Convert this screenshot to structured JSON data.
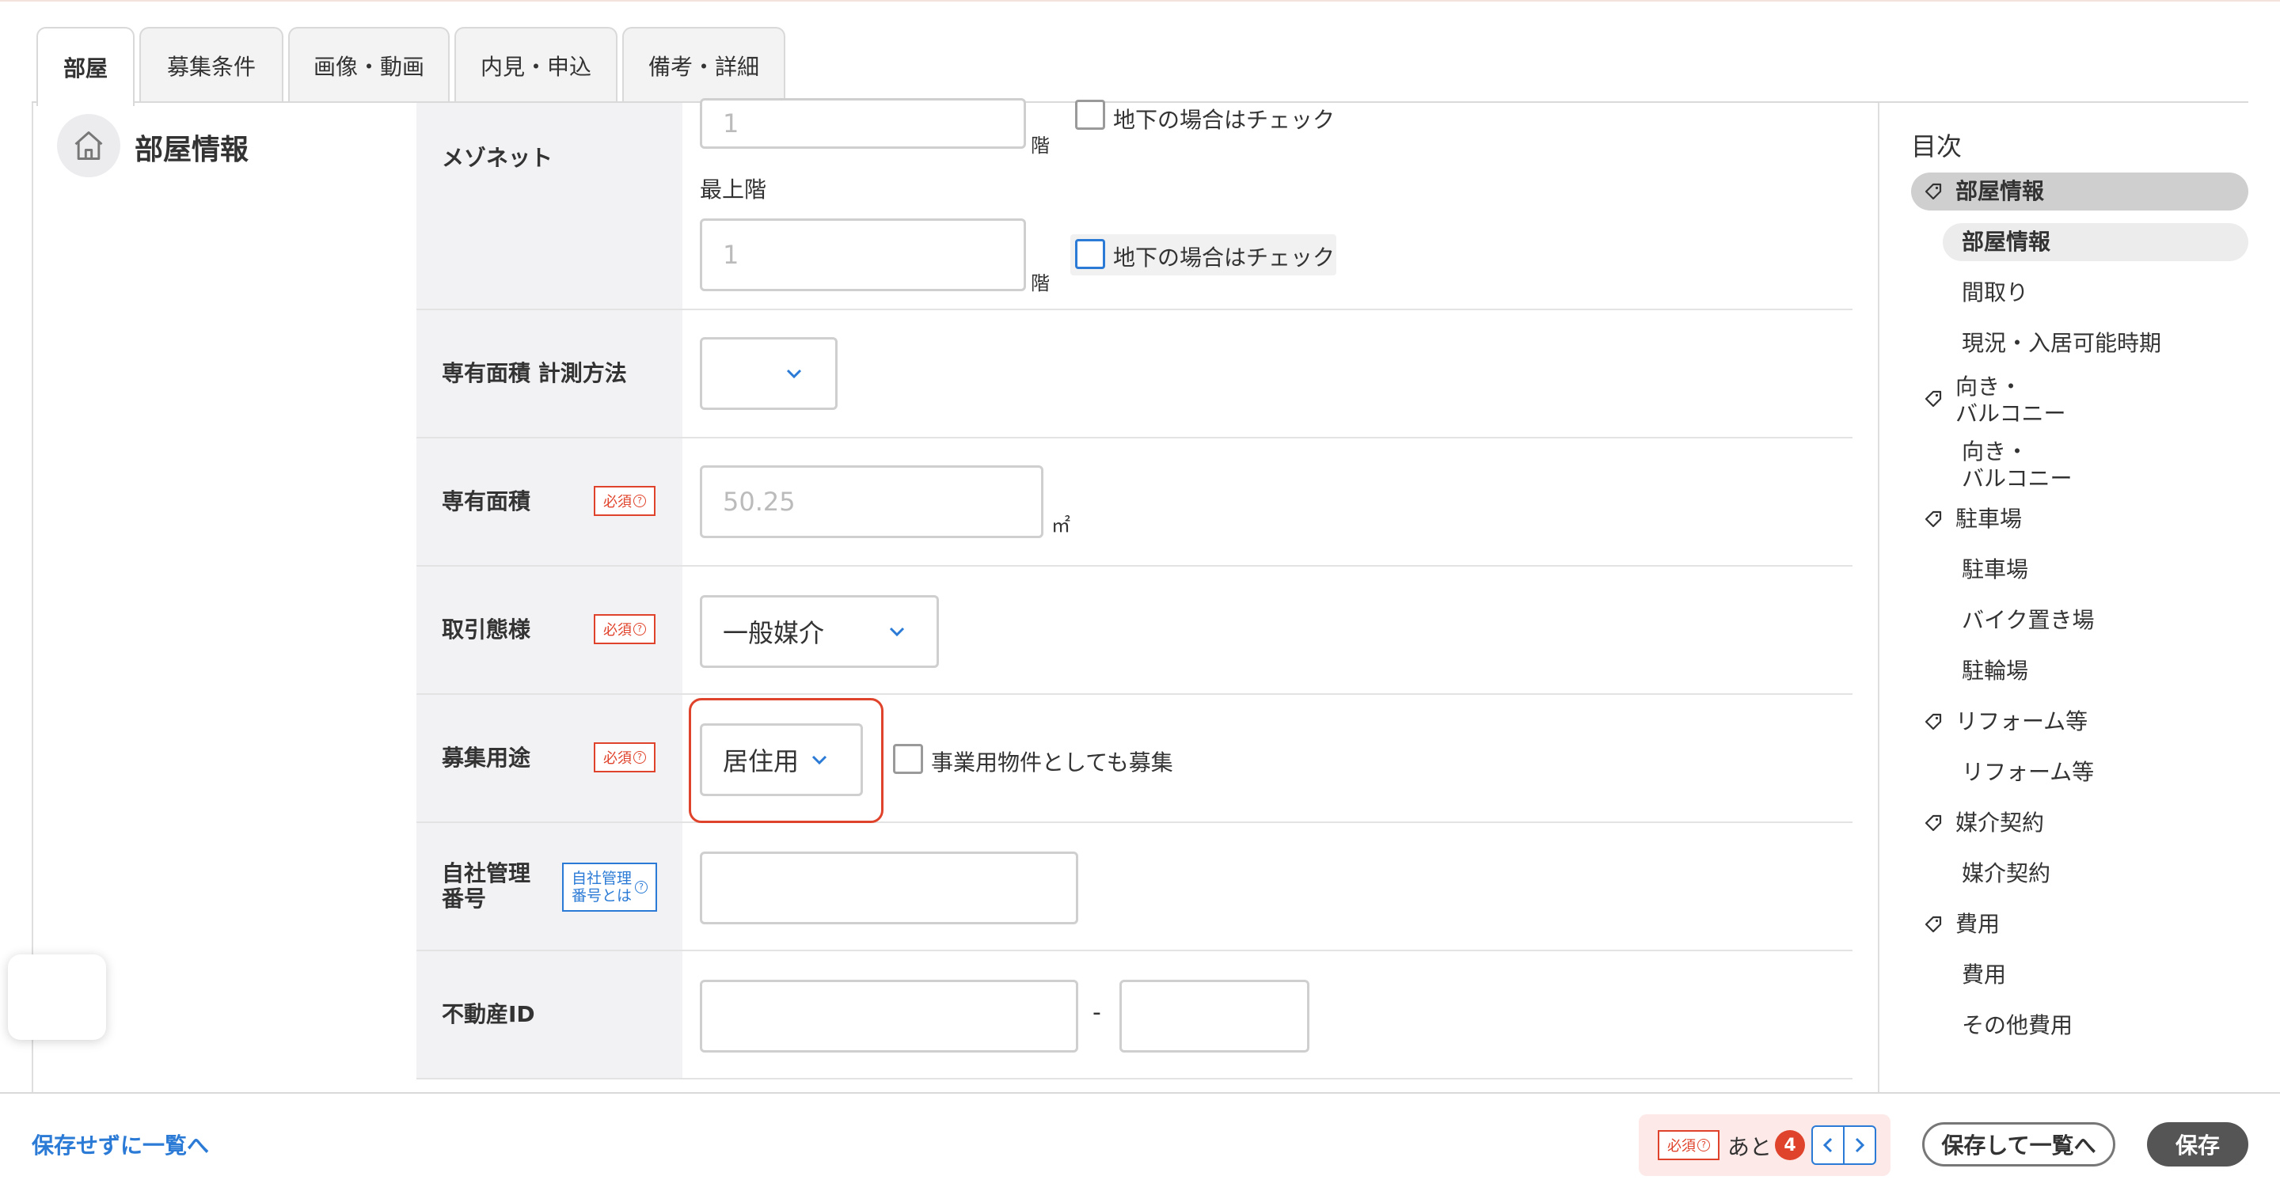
{
  "tabs": [
    "部屋",
    "募集条件",
    "画像・動画",
    "内見・申込",
    "備考・詳細"
  ],
  "section": {
    "title": "部屋情報",
    "icon": "home-icon"
  },
  "form": {
    "maisonette": {
      "label": "メゾネット",
      "lower_value": "1",
      "floor_unit": "階",
      "basement_check_label": "地下の場合はチェック",
      "top_floor_label": "最上階",
      "upper_value": "1"
    },
    "area_method": {
      "label": "専有面積 計測方法",
      "value": ""
    },
    "area": {
      "label": "専有面積",
      "required": "必須",
      "placeholder": "50.25",
      "unit": "㎡"
    },
    "transaction": {
      "label": "取引態様",
      "required": "必須",
      "value": "一般媒介"
    },
    "purpose": {
      "label": "募集用途",
      "required": "必須",
      "value": "居住用",
      "business_check_label": "事業用物件としても募集"
    },
    "mgmt_no": {
      "label_line1": "自社管理",
      "label_line2": "番号",
      "help_line1": "自社管理",
      "help_line2": "番号とは",
      "value": ""
    },
    "realestate_id": {
      "label": "不動産ID",
      "separator": "-",
      "value1": "",
      "value2": ""
    }
  },
  "toc": {
    "title": "目次",
    "groups": [
      {
        "label": "部屋情報",
        "items": [
          "部屋情報",
          "間取り",
          "現況・入居可能時期"
        ]
      },
      {
        "label": "向き・\nバルコニー",
        "items": [
          "向き・\nバルコニー"
        ]
      },
      {
        "label": "駐車場",
        "items": [
          "駐車場",
          "バイク置き場",
          "駐輪場"
        ]
      },
      {
        "label": "リフォーム等",
        "items": [
          "リフォーム等"
        ]
      },
      {
        "label": "媒介契約",
        "items": [
          "媒介契約"
        ]
      },
      {
        "label": "費用",
        "items": [
          "費用",
          "その他費用"
        ]
      }
    ]
  },
  "footer": {
    "back_link": "保存せずに一覧へ",
    "required_label": "必須",
    "remaining_prefix": "あと",
    "remaining_count": "4",
    "save_and_list": "保存して一覧へ",
    "save": "保存"
  },
  "colors": {
    "accent_blue": "#2b7bd6",
    "required_red": "#e0432b",
    "highlight_red": "#e0432b"
  }
}
